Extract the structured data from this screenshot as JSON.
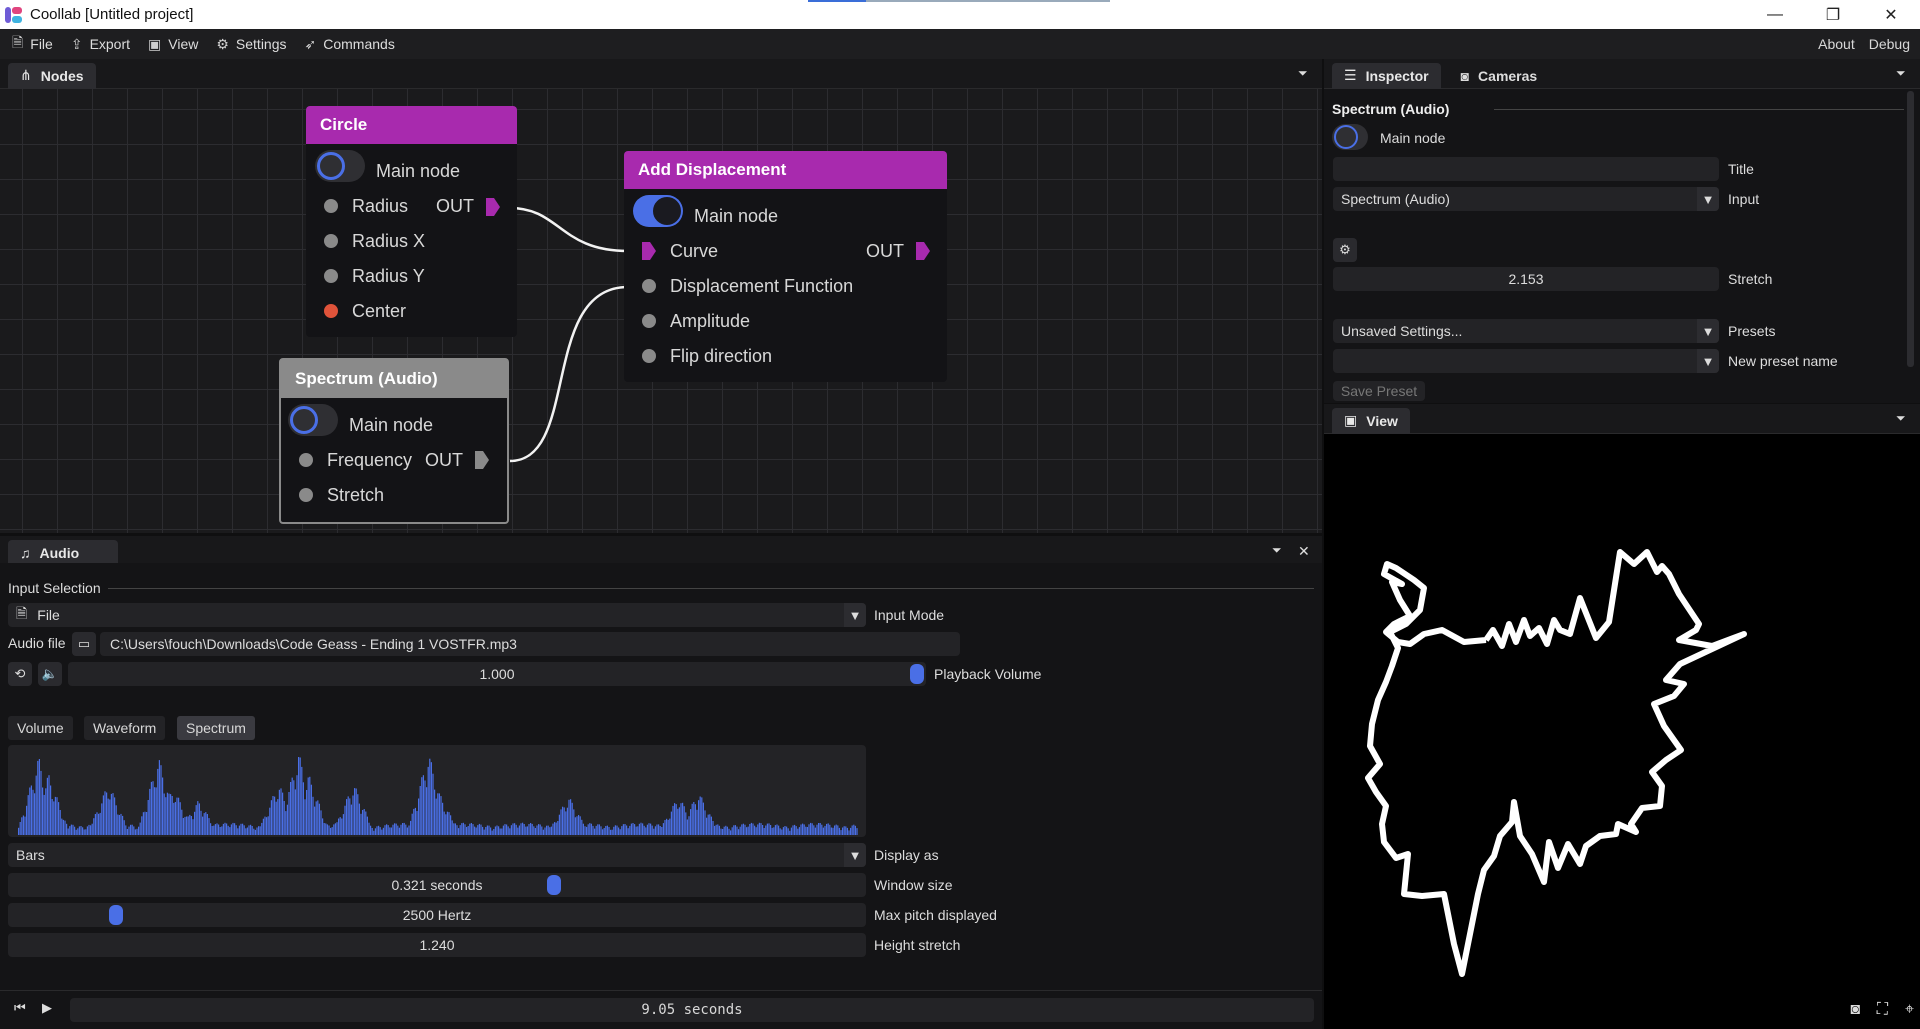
{
  "window": {
    "title": "Coollab [Untitled project]",
    "minimize": "—",
    "maximize": "❐",
    "close": "✕"
  },
  "menu": {
    "file": "File",
    "export": "Export",
    "view": "View",
    "settings": "Settings",
    "commands": "Commands",
    "about": "About",
    "debug": "Debug"
  },
  "nodes_panel": {
    "tab": "Nodes"
  },
  "nodes": {
    "circle": {
      "title": "Circle",
      "main": "Main node",
      "out": "OUT",
      "rows": [
        "Radius",
        "Radius X",
        "Radius Y",
        "Center"
      ]
    },
    "spectrum": {
      "title": "Spectrum (Audio)",
      "main": "Main node",
      "out": "OUT",
      "rows": [
        "Frequency",
        "Stretch"
      ]
    },
    "displacement": {
      "title": "Add Displacement",
      "main": "Main node",
      "out": "OUT",
      "rows": [
        "Curve",
        "Displacement Function",
        "Amplitude",
        "Flip direction"
      ]
    }
  },
  "inspector": {
    "tab": "Inspector",
    "cameras_tab": "Cameras",
    "section_title": "Spectrum (Audio)",
    "main_node": "Main node",
    "title_label": "Title",
    "title_value": "",
    "input_label": "Input",
    "input_value": "Spectrum (Audio)",
    "stretch_label": "Stretch",
    "stretch_value": "2.153",
    "presets_label": "Presets",
    "presets_value": "Unsaved Settings...",
    "new_preset_label": "New preset name",
    "new_preset_value": "",
    "save_preset": "Save Preset"
  },
  "view_panel": {
    "tab": "View"
  },
  "audio": {
    "tab": "Audio",
    "input_selection": "Input Selection",
    "input_mode_value": "File",
    "input_mode_label": "Input Mode",
    "audio_file_label": "Audio file",
    "audio_file_path": "C:\\Users\\fouch\\Downloads\\Code Geass - Ending 1 VOSTFR.mp3",
    "volume_value": "1.000",
    "volume_label": "Playback Volume",
    "volume_level": 1.0,
    "tabs": [
      "Volume",
      "Waveform",
      "Spectrum"
    ],
    "active_tab": "Spectrum",
    "display_as_value": "Bars",
    "display_as_label": "Display as",
    "window_size_value": "0.321 seconds",
    "window_size_label": "Window size",
    "window_size_level": 0.64,
    "max_pitch_value": "2500 Hertz",
    "max_pitch_label": "Max pitch displayed",
    "max_pitch_level": 0.12,
    "height_stretch_value": "1.240",
    "height_stretch_label": "Height stretch"
  },
  "timeline": {
    "time": "9.05 seconds"
  },
  "colors": {
    "accent": "#4a6fe6",
    "node_header": "#a82aae",
    "spectrum_header": "#8a8a8a",
    "center_pin": "#e0533a"
  }
}
